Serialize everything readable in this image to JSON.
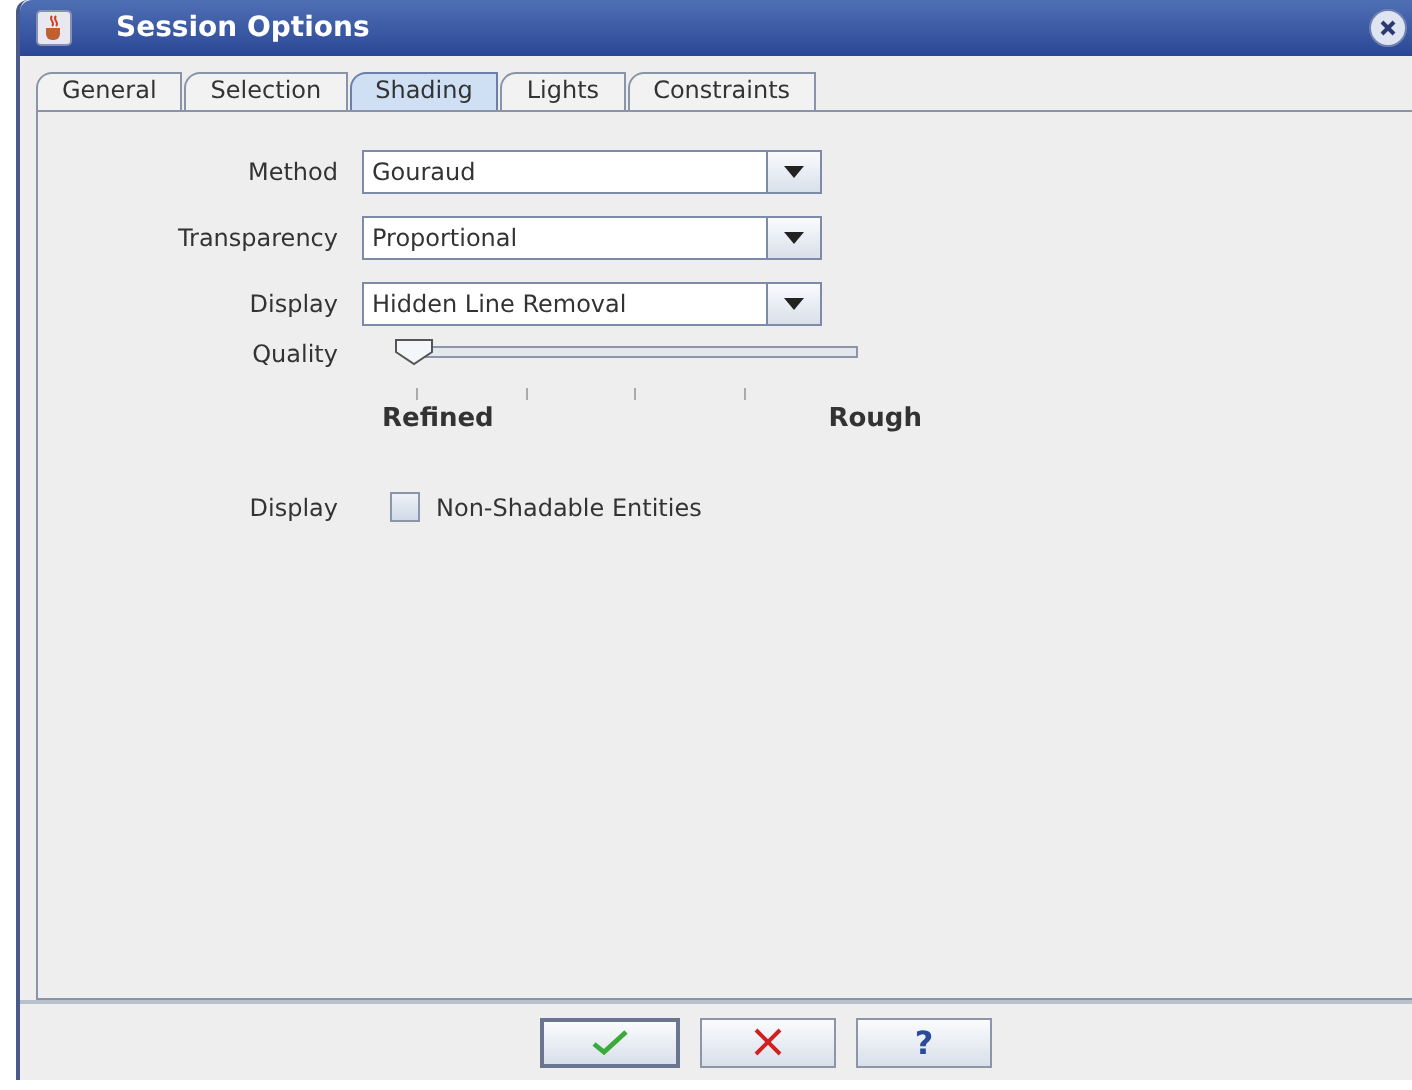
{
  "window": {
    "title": "Session Options"
  },
  "tabs": [
    {
      "label": "General",
      "selected": false
    },
    {
      "label": "Selection",
      "selected": false
    },
    {
      "label": "Shading",
      "selected": true
    },
    {
      "label": "Lights",
      "selected": false
    },
    {
      "label": "Constraints",
      "selected": false
    }
  ],
  "fields": [
    {
      "kind": "combo",
      "label": "Method",
      "value": "Gouraud"
    },
    {
      "kind": "combo",
      "label": "Transparency",
      "value": "Proportional"
    },
    {
      "kind": "combo",
      "label": "Display",
      "value": "Hidden Line Removal"
    },
    {
      "kind": "slider",
      "label": "Quality",
      "level": 0.0,
      "min_label": "Refined",
      "max_label": "Rough"
    },
    {
      "kind": "checkbox",
      "label": "Display",
      "text": "Non-Shadable Entities",
      "checked": false
    }
  ],
  "buttons": [
    {
      "kind": "ok"
    },
    {
      "kind": "cancel"
    },
    {
      "kind": "help",
      "text": "?"
    }
  ]
}
